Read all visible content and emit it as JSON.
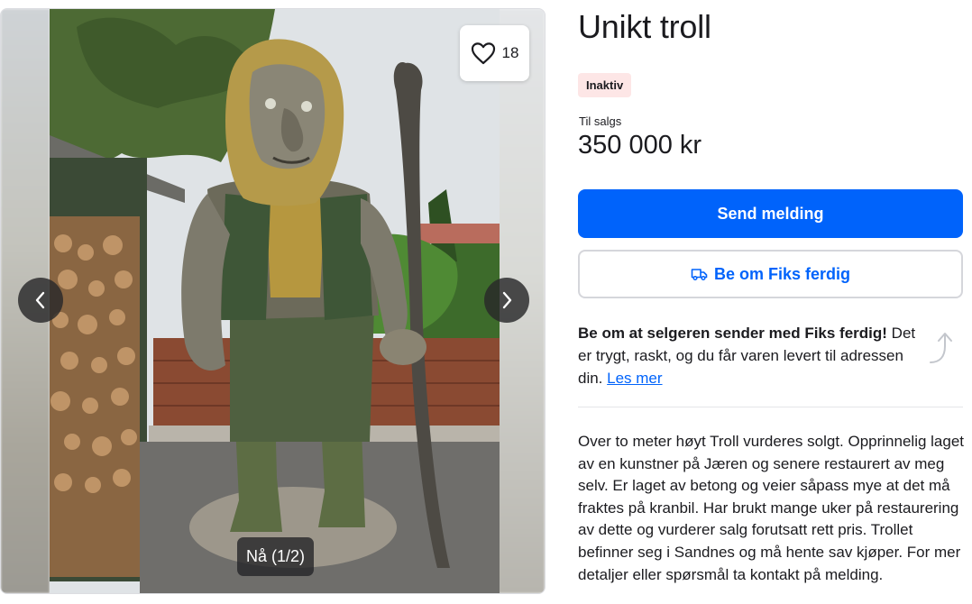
{
  "listing": {
    "title": "Unikt troll",
    "status": "Inaktiv",
    "price_label": "Til salgs",
    "price": "350 000 kr",
    "description": "Over to meter høyt Troll vurderes solgt. Opprinnelig laget av en kunstner på Jæren og senere restaurert av meg selv. Er laget av betong og veier såpass mye at det må fraktes på kranbil. Har brukt mange uker på restaurering av dette og vurderer salg forutsatt rett pris. Trollet befinner seg i Sandnes og må hente sav kjøper. For mer detaljer eller spørsmål ta kontakt på melding."
  },
  "gallery": {
    "favorite_count": "18",
    "image_counter": "Nå (1/2)",
    "favorite_icon": "heart-outline-icon",
    "prev_icon": "chevron-left-icon",
    "next_icon": "chevron-right-icon"
  },
  "actions": {
    "send_message_label": "Send melding",
    "fiks_ferdig_label": "Be om Fiks ferdig",
    "fiks_ferdig_icon": "truck-icon"
  },
  "promo": {
    "bold_text": "Be om at selgeren sender med Fiks ferdig!",
    "text": " Det er trygt, raskt, og du får varen levert til adressen din. ",
    "link_text": "Les mer",
    "icon": "curved-arrow-up-icon"
  },
  "colors": {
    "primary": "#0063fb",
    "badge_background": "#fde6e6",
    "text": "#1b1b1f"
  }
}
